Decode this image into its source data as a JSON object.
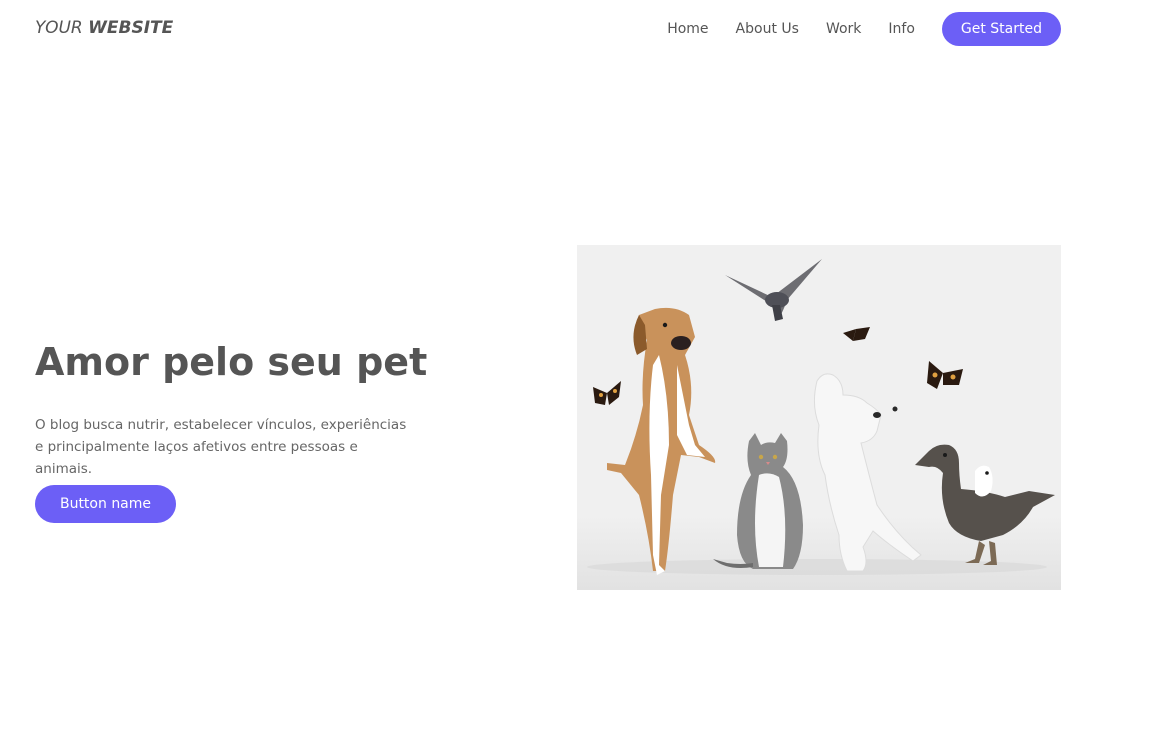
{
  "header": {
    "logo_prefix": "YOUR",
    "logo_bold": "WEBSITE",
    "nav": [
      "Home",
      "About Us",
      "Work",
      "Info"
    ],
    "cta_label": "Get Started"
  },
  "hero": {
    "title": "Amor pelo seu pet",
    "text": "O blog busca nutrir, estabelecer vínculos, experiências e principalmente laços afetivos entre pessoas e animais.",
    "button_label": "Button name"
  },
  "colors": {
    "accent": "#6c5ff6",
    "text": "#555555",
    "image_bg": "#f0f0f0"
  }
}
